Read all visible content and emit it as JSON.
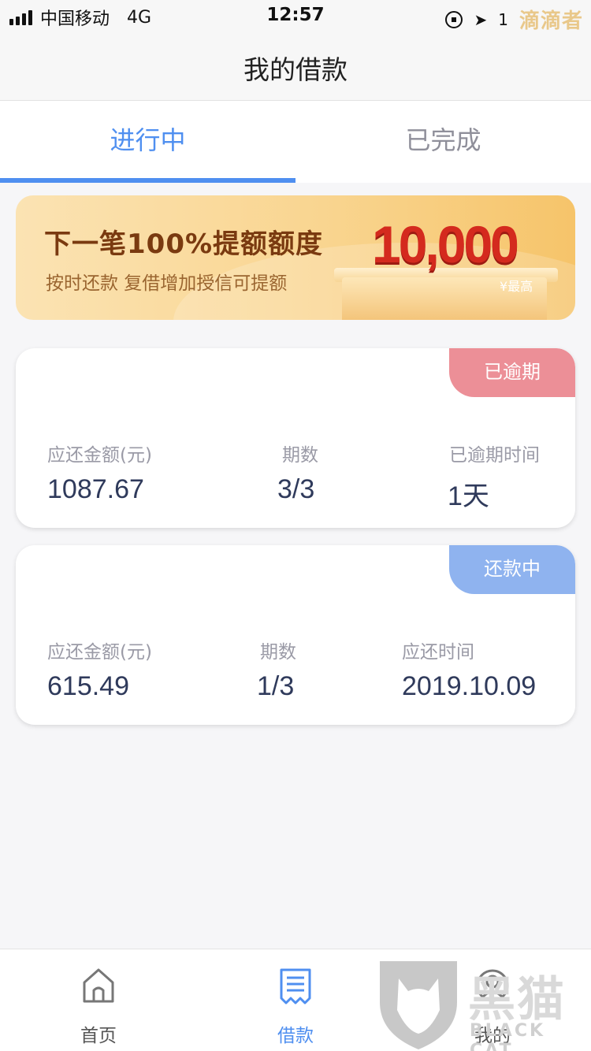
{
  "status_bar": {
    "carrier": "中国移动",
    "network": "4G",
    "time": "12:57",
    "battery": "1",
    "watermark_top": "滴滴者"
  },
  "nav": {
    "title": "我的借款"
  },
  "tabs": [
    {
      "label": "进行中",
      "active": true
    },
    {
      "label": "已完成",
      "active": false
    }
  ],
  "banner": {
    "title": "下一笔100%提额额度",
    "subtitle": "按时还款  复借增加授信可提额",
    "amount": "10,000",
    "note": "¥最高"
  },
  "loans": [
    {
      "badge": "已逾期",
      "amount_label": "应还金额(元)",
      "amount": "1087.67",
      "period_label": "期数",
      "period": "3/3",
      "third_label": "已逾期时间",
      "third_value": "1天"
    },
    {
      "badge": "还款中",
      "amount_label": "应还金额(元)",
      "amount": "615.49",
      "period_label": "期数",
      "period": "1/3",
      "third_label": "应还时间",
      "third_value": "2019.10.09"
    }
  ],
  "tabbar": [
    {
      "label": "首页",
      "icon": "home-icon"
    },
    {
      "label": "借款",
      "icon": "bill-icon",
      "active": true
    },
    {
      "label": "我的",
      "icon": "user-icon"
    }
  ],
  "watermark": {
    "text": "黑猫",
    "sub": "BLACK CAT"
  },
  "colors": {
    "accent": "#4f8ff0",
    "overdue": "#ec8f97",
    "repaying": "#8fb3ef",
    "amount_red": "#d42a1e"
  }
}
